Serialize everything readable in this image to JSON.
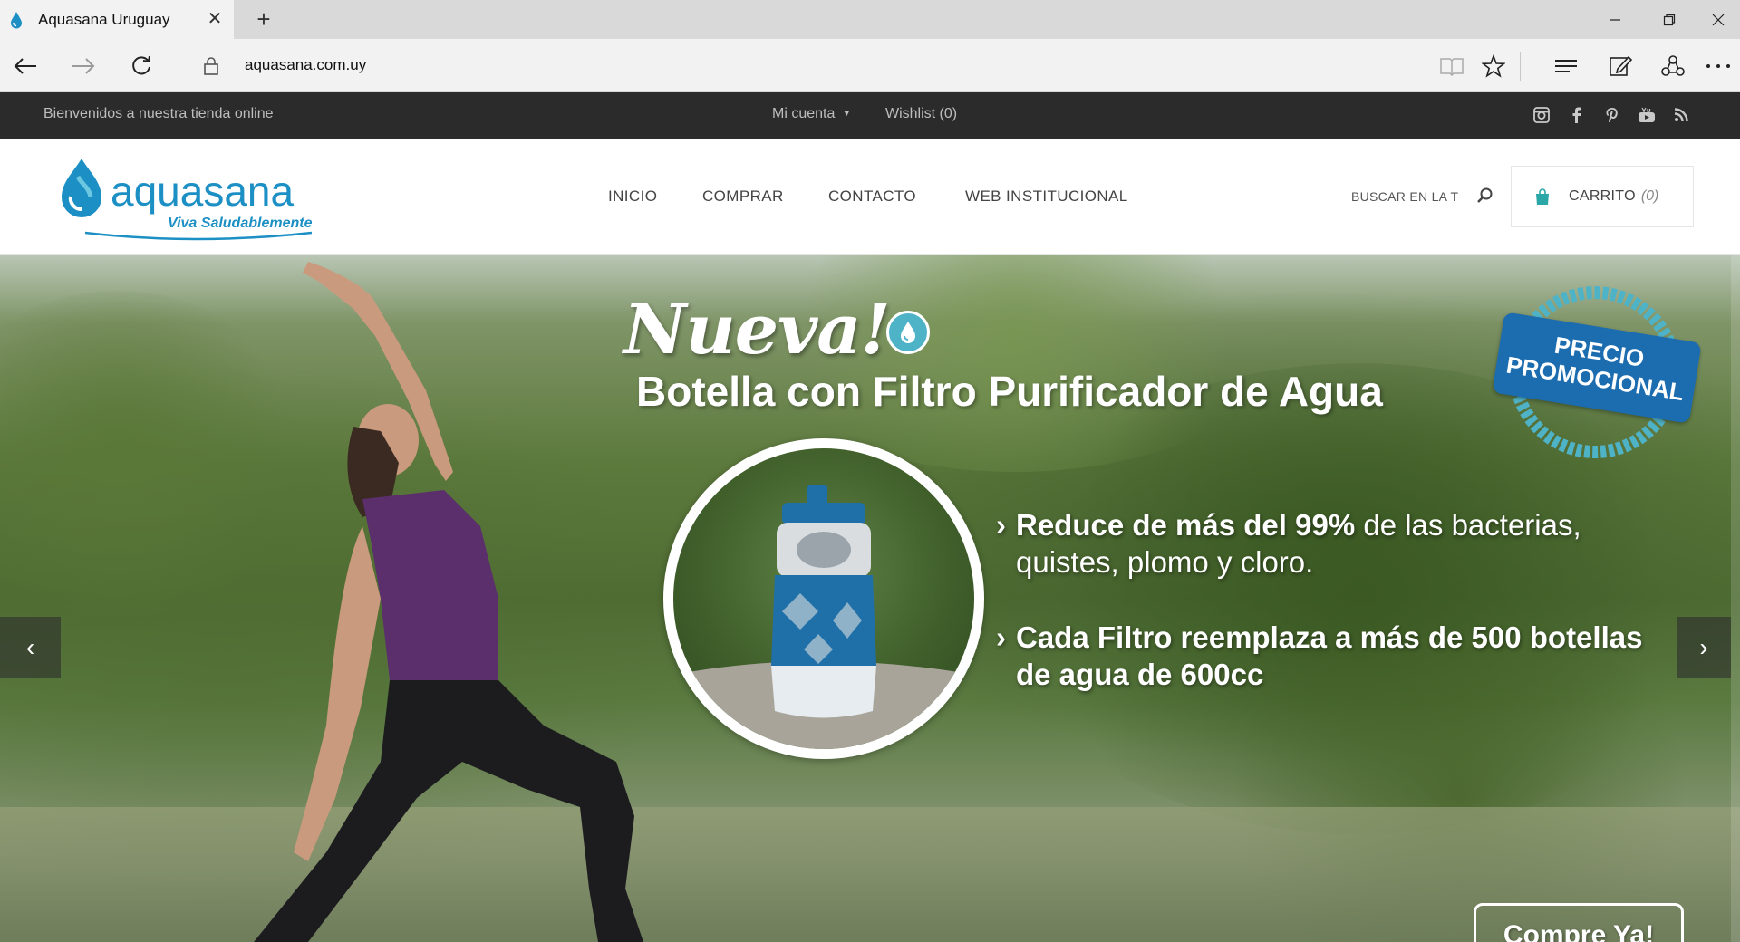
{
  "browser": {
    "tab_title": "Aquasana Uruguay",
    "url": "aquasana.com.uy"
  },
  "topbar": {
    "welcome": "Bienvenidos a nuestra tienda online",
    "account": "Mi cuenta",
    "wishlist": "Wishlist (0)",
    "social_icons": [
      "instagram-icon",
      "facebook-icon",
      "pinterest-icon",
      "youtube-icon",
      "rss-icon"
    ]
  },
  "header": {
    "logo_name": "aquasana",
    "logo_tagline": "Viva Saludablemente",
    "nav": [
      "INICIO",
      "COMPRAR",
      "CONTACTO",
      "WEB INSTITUCIONAL"
    ],
    "search_placeholder": "BUSCAR EN LA T",
    "cart_label": "CARRITO",
    "cart_count": "(0)"
  },
  "hero": {
    "headline": "Nueva!",
    "title": "Botella con Filtro Purificador de Agua",
    "badge_line1": "PRECIO",
    "badge_line2": "PROMOCIONAL",
    "bullet1_bold": "Reduce de más del 99%",
    "bullet1_rest": " de las bacterias,",
    "bullet1_line2": "quistes, plomo y cloro.",
    "bullet2_line1": "Cada Filtro reemplaza a más de 500 botellas",
    "bullet2_line2": "de agua de 600cc",
    "cta": "Compre Ya!"
  },
  "colors": {
    "brand_blue": "#1c8fc4",
    "topbar_bg": "#2b2b2b",
    "badge_blue": "#1c6cb0",
    "badge_ring": "#4fb3c8"
  }
}
